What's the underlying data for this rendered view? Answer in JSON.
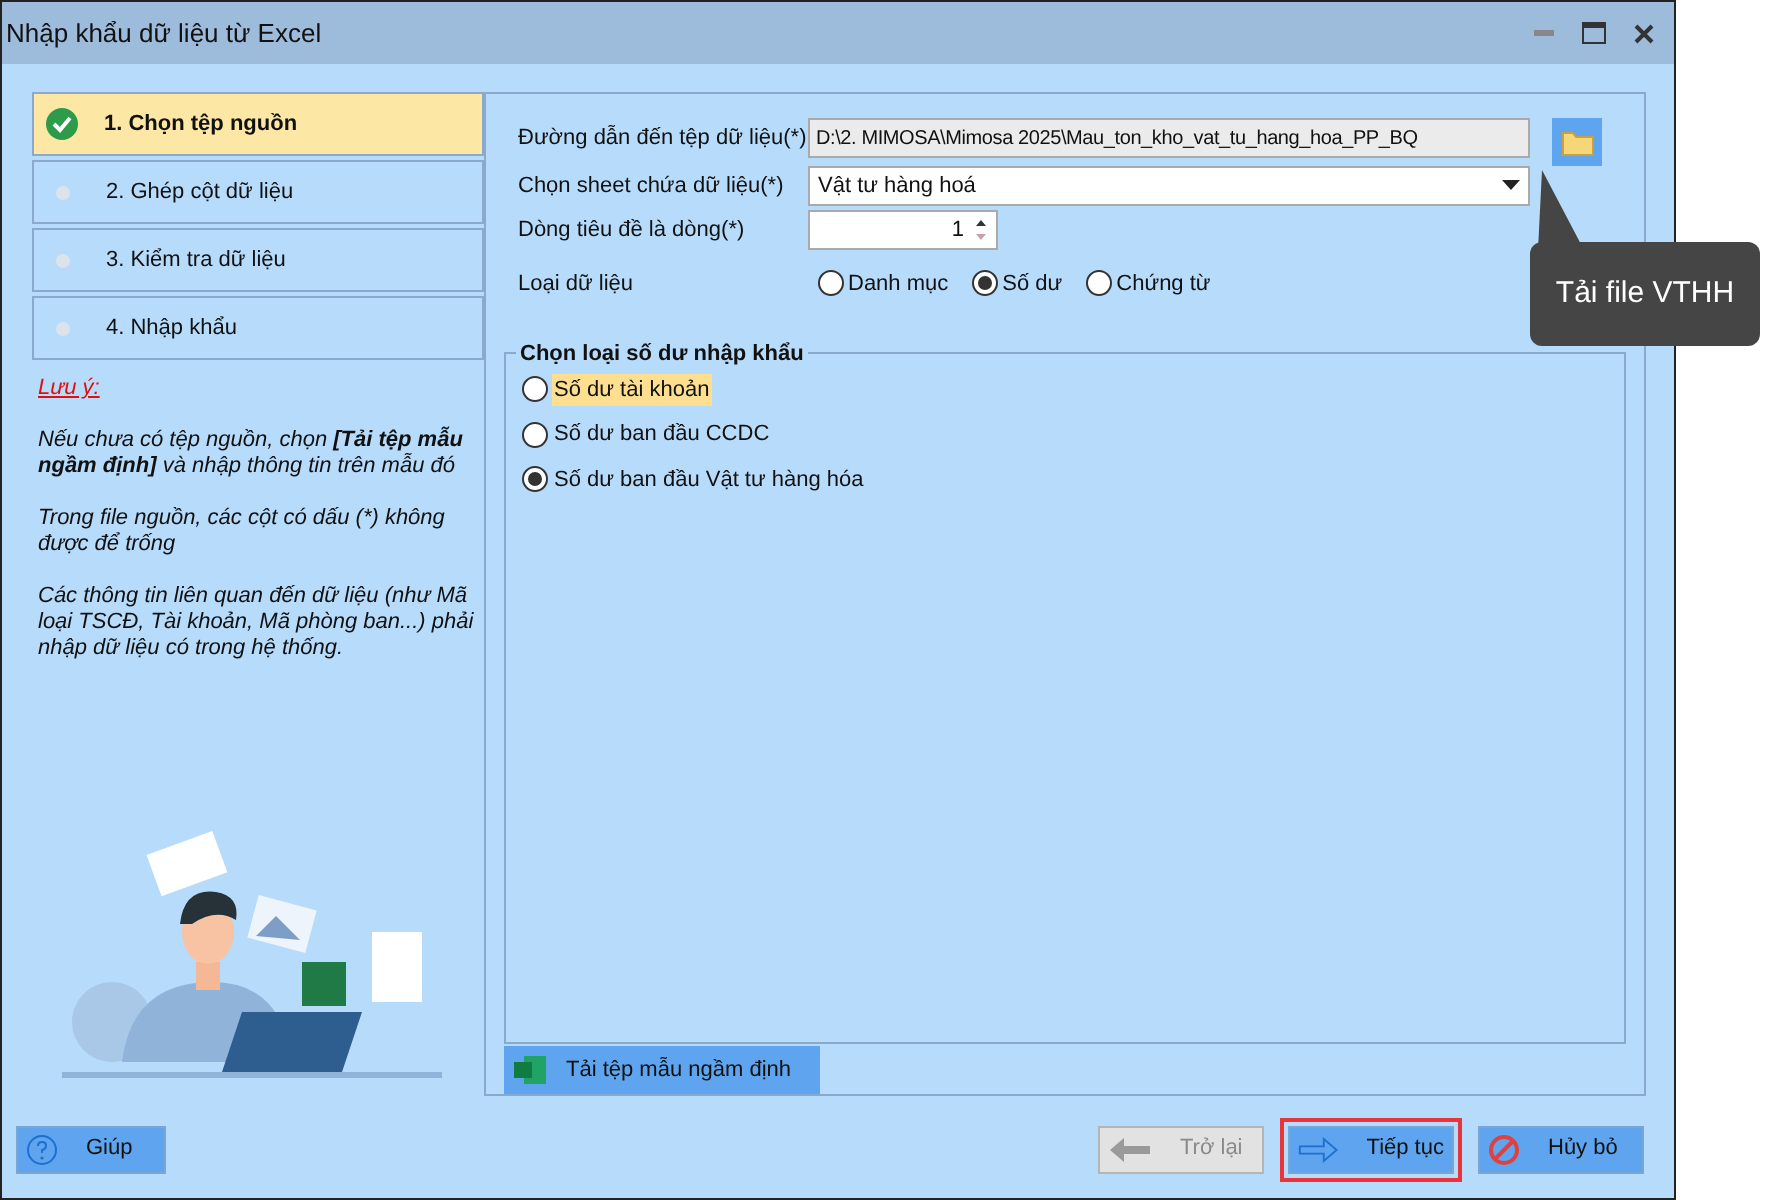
{
  "window": {
    "title": "Nhập khẩu dữ liệu từ Excel"
  },
  "steps": [
    {
      "label": "1. Chọn tệp nguồn",
      "selected": true,
      "done": true
    },
    {
      "label": "2. Ghép cột dữ liệu",
      "selected": false,
      "done": false
    },
    {
      "label": "3. Kiểm tra dữ liệu",
      "selected": false,
      "done": false
    },
    {
      "label": "4. Nhập khẩu",
      "selected": false,
      "done": false
    }
  ],
  "note": {
    "title": "Lưu ý:",
    "paragraphs": [
      "Nếu chưa có tệp nguồn, chọn **[Tải tệp mẫu ngầm định]** và nhập thông tin trên mẫu đó",
      "Trong file nguồn, các cột có dấu (*) không được để trống",
      "Các thông tin liên quan đến dữ liệu (như Mã loại TSCĐ, Tài khoản, Mã phòng ban...) phải nhập dữ liệu có trong hệ thống."
    ]
  },
  "form": {
    "path_label": "Đường dẫn đến tệp dữ liệu(*)",
    "path_value": "D:\\2. MIMOSA\\Mimosa 2025\\Mau_ton_kho_vat_tu_hang_hoa_PP_BQ",
    "sheet_label": "Chọn sheet chứa dữ liệu(*)",
    "sheet_value": "Vật tư hàng hoá",
    "header_row_label": "Dòng tiêu đề là dòng(*)",
    "header_row_value": "1",
    "data_type_label": "Loại dữ liệu",
    "data_types": [
      {
        "label": "Danh mục",
        "selected": false
      },
      {
        "label": "Số dư",
        "selected": true
      },
      {
        "label": "Chứng từ",
        "selected": false
      }
    ]
  },
  "tooltip": "Tải file VTHH",
  "balance_group": {
    "title": "Chọn loại số dư nhập khẩu",
    "options": [
      {
        "label": "Số dư tài khoản",
        "selected": false,
        "highlighted": true
      },
      {
        "label": "Số dư ban đầu CCDC",
        "selected": false,
        "highlighted": false
      },
      {
        "label": "Số dư ban đầu Vật tư hàng hóa",
        "selected": true,
        "highlighted": false
      }
    ]
  },
  "template_button": "Tải tệp mẫu ngầm định",
  "help_button": "Giúp",
  "buttons": [
    {
      "kind": "back",
      "label": "Trở lại",
      "disabled": true,
      "outlined": false
    },
    {
      "kind": "next",
      "label": "Tiếp tục",
      "disabled": false,
      "outlined": true
    },
    {
      "kind": "cancel",
      "label": "Hủy bỏ",
      "disabled": false,
      "outlined": false
    }
  ]
}
